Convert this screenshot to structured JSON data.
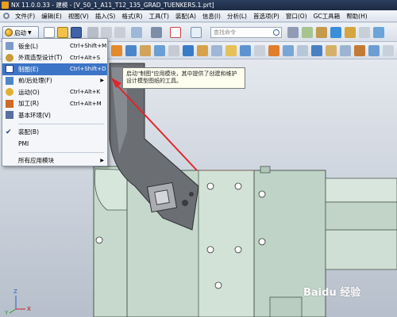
{
  "window": {
    "title": "NX 11.0.0.33 - 建模 - [V_50_1_A11_T12_135_GRAD_TUENKERS.1.prt]"
  },
  "menubar": {
    "items": [
      "文件(F)",
      "编辑(E)",
      "视图(V)",
      "插入(S)",
      "格式(R)",
      "工具(T)",
      "装配(A)",
      "信息(I)",
      "分析(L)",
      "首选项(P)",
      "窗口(O)",
      "GC工具箱",
      "帮助(H)"
    ]
  },
  "toolbar": {
    "start_label": "启动",
    "search_placeholder": "查找命令"
  },
  "start_menu": {
    "items": [
      {
        "label": "钣金(L)",
        "shortcut": "Ctrl+Shift+M"
      },
      {
        "label": "外观造型设计(T)",
        "shortcut": "Ctrl+Alt+S"
      },
      {
        "label": "制图(E)",
        "shortcut": "Ctrl+Shift+D"
      },
      {
        "label": "前/后处理(F)",
        "shortcut": ""
      },
      {
        "label": "运动(O)",
        "shortcut": "Ctrl+Alt+K"
      },
      {
        "label": "加工(R)",
        "shortcut": "Ctrl+Alt+M"
      },
      {
        "label": "基本环境(V)",
        "shortcut": ""
      },
      {
        "label": "装配(B)",
        "shortcut": ""
      },
      {
        "label": "PMI",
        "shortcut": ""
      },
      {
        "label": "所有应用模块",
        "shortcut": ""
      }
    ]
  },
  "tooltip": {
    "text": "启动\"制图\"应用模块，其中提供了创建和维护设计模型图纸的工具。"
  },
  "viewport": {
    "axis_z": "Z",
    "axis_x": "X",
    "axis_y": "Y"
  },
  "watermark": {
    "text": "Baidu 经验"
  },
  "colors": {
    "menu_highlight": "#3c74c6",
    "model_green": "#c6d8cc",
    "part_dark": "#6b6e72",
    "arrow_red": "#e0262a"
  }
}
